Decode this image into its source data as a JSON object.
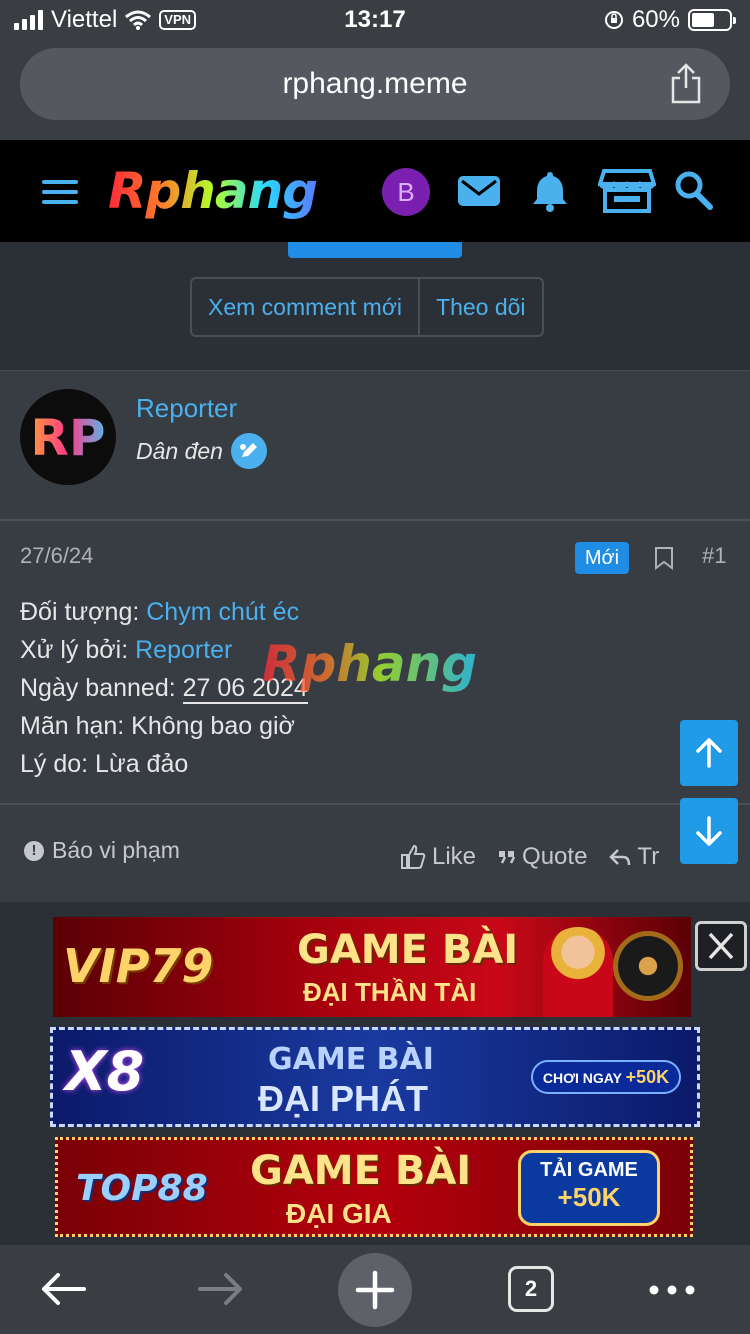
{
  "status_bar": {
    "carrier": "Viettel",
    "vpn": "VPN",
    "time": "13:17",
    "battery": "60%",
    "battery_level": 0.6
  },
  "browser": {
    "url": "rphang.meme",
    "tab_count": "2"
  },
  "site_header": {
    "logo": "Rphang",
    "user_initial": "B",
    "accent_color": "#4ab0ee",
    "icons": [
      "menu-icon",
      "mail-icon",
      "bell-icon",
      "store-icon",
      "search-icon"
    ]
  },
  "thread_actions": {
    "new_comments": "Xem comment mới",
    "follow": "Theo dõi"
  },
  "post": {
    "author": {
      "avatar_text": "RP",
      "name": "Reporter",
      "title": "Dân đen"
    },
    "date": "27/6/24",
    "badge": "Mới",
    "number": "#1",
    "fields": {
      "target_label": "Đối tượng:",
      "target_value": "Chym chút éc",
      "handled_label": "Xử lý bởi:",
      "handled_value": "Reporter",
      "banned_label": "Ngày banned:",
      "banned_value": "27 06 2024",
      "expiry": "Mãn hạn: Không bao giờ",
      "reason": "Lý do: Lừa đảo"
    },
    "watermark": "Rphang",
    "footer": {
      "report": "Báo vi phạm",
      "like": "Like",
      "quote": "Quote",
      "reply": "Tr"
    }
  },
  "ads": [
    {
      "brand": "VIP79",
      "line1": "GAME BÀI",
      "line2": "ĐẠI THẦN TÀI"
    },
    {
      "brand": "X8",
      "line1": "GAME BÀI",
      "line2": "ĐẠI PHÁT",
      "cta_text": "CHƠI NGAY",
      "cta_amount": "+50K"
    },
    {
      "brand": "TOP88",
      "line1": "GAME BÀI",
      "line2": "ĐẠI GIA",
      "cta_line1": "TẢI GAME",
      "cta_line2": "+50K"
    }
  ]
}
